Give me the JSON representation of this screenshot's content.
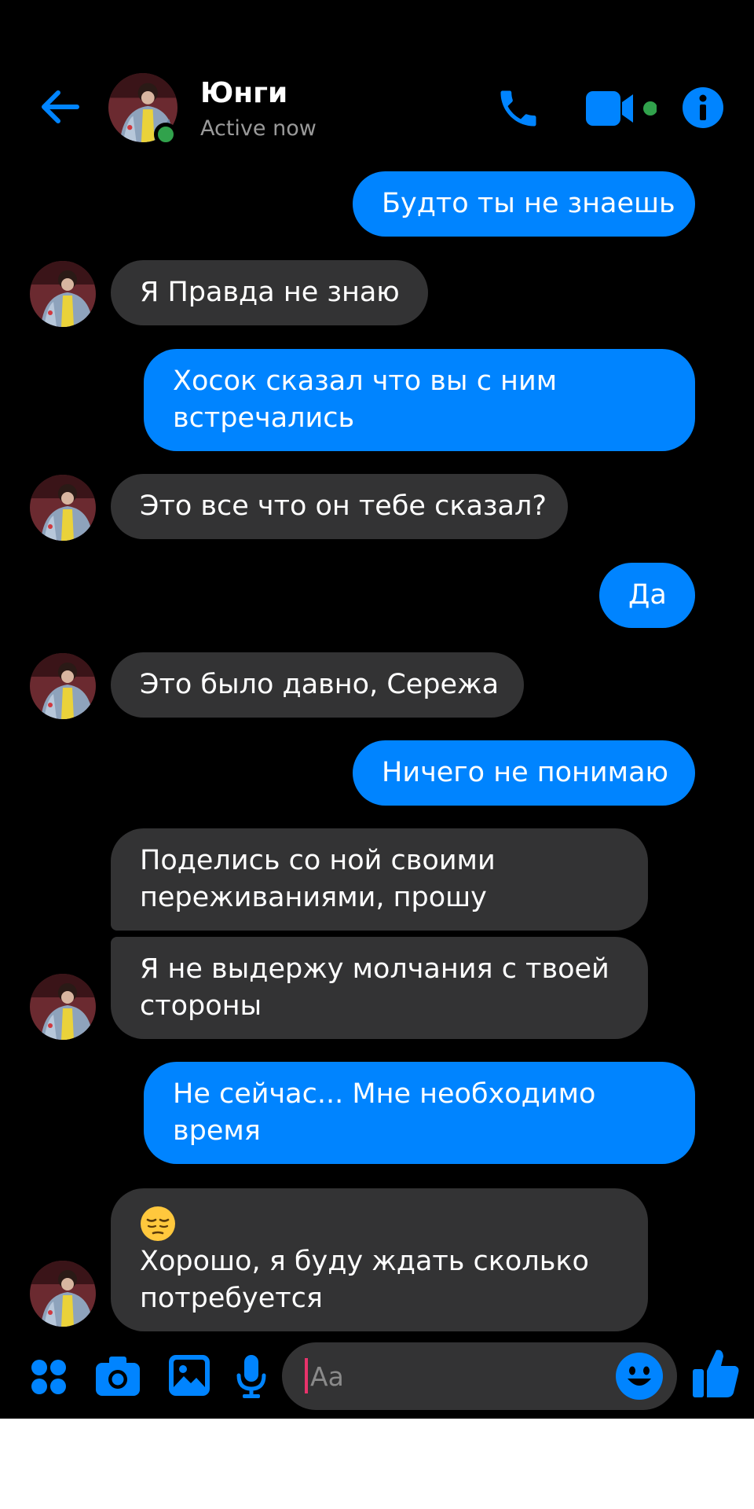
{
  "header": {
    "contact_name": "Юнги",
    "status": "Active now",
    "icons": [
      "back-arrow-icon",
      "phone-icon",
      "video-camera-icon",
      "info-icon"
    ]
  },
  "messages": [
    {
      "direction": "out",
      "text": "Будто ты не знаешь"
    },
    {
      "direction": "in",
      "text": "Я Правда не знаю"
    },
    {
      "direction": "out",
      "lines": [
        "Хосок сказал что вы с ним",
        "встречались"
      ]
    },
    {
      "direction": "in",
      "text": "Это все что он тебе сказал?"
    },
    {
      "direction": "out",
      "text": "Да"
    },
    {
      "direction": "in",
      "text": "Это было давно, Сережа"
    },
    {
      "direction": "out",
      "text": "Ничего не понимаю"
    },
    {
      "direction": "in",
      "lines": [
        "Поделись со ной своими",
        "переживаниями, прошу"
      ]
    },
    {
      "direction": "in",
      "lines": [
        "Я не выдержу молчания с твоей",
        "стороны"
      ]
    },
    {
      "direction": "out",
      "lines": [
        "Не сейчас... Мне необходимо",
        "время"
      ]
    },
    {
      "direction": "in",
      "emoji": "pensive-face-emoji",
      "lines": [
        "Хорошо, я буду ждать сколько",
        "потребуется"
      ]
    }
  ],
  "composer": {
    "placeholder": "Aa",
    "icons": [
      "apps-icon",
      "camera-icon",
      "gallery-icon",
      "microphone-icon",
      "emoji-icon",
      "thumbs-up-icon"
    ]
  },
  "colors": {
    "background": "#000000",
    "accent": "#0084ff",
    "incoming_bubble": "#333334",
    "online": "#31a24c",
    "status_text": "#9a9a9a",
    "caret": "#e8336b"
  }
}
